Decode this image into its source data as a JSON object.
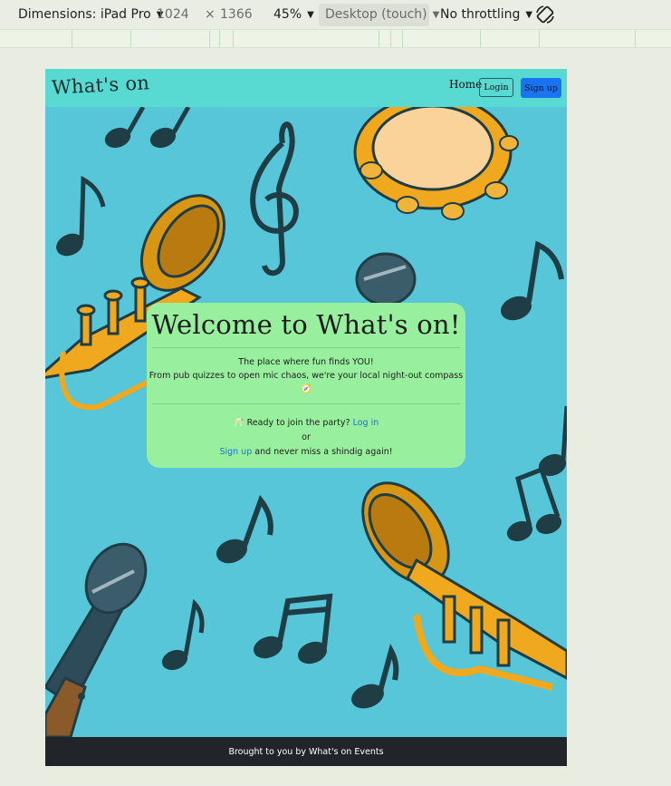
{
  "devtools": {
    "device_label": "Dimensions: iPad Pro",
    "width": "1024",
    "times": "×",
    "height": "1366",
    "zoom": "45%",
    "mode": "Desktop (touch)",
    "throttling": "No throttling",
    "icons": [
      "caret-down-icon",
      "rotate-icon"
    ]
  },
  "nav": {
    "brand": "What's on",
    "home": "Home",
    "login": "Login",
    "signup": "Sign up"
  },
  "hero": {
    "title": "Welcome to What's on!",
    "tagline_1": "The place where fun finds YOU!",
    "tagline_2": "From pub quizzes to open mic chaos, we're your local night-out compass 🧭",
    "cta_prefix": "🥂 Ready to join the party?",
    "cta_login": "Log in",
    "cta_or": "or",
    "cta_signup": "Sign up",
    "cta_suffix": "and never miss a shindig again!"
  },
  "footer": {
    "text": "Brought to you by What's on Events"
  },
  "colors": {
    "background": "#56c6d8",
    "navbar": "#58d9d1",
    "card": "#98ef9e",
    "primary": "#1a74f2",
    "footer": "#212529",
    "note": "#1f3d45",
    "brass": "#f0a81e"
  }
}
